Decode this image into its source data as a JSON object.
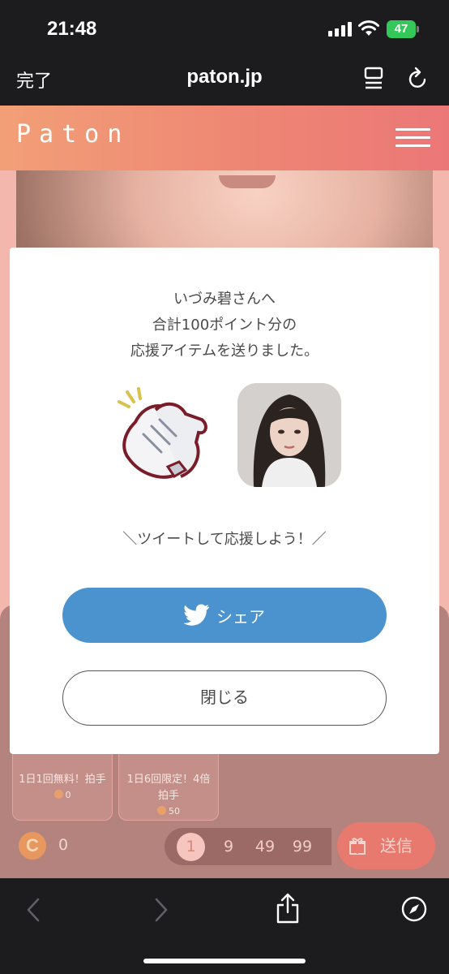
{
  "status_bar": {
    "time": "21:48",
    "battery": "47"
  },
  "browser": {
    "done_label": "完了",
    "url": "paton.jp"
  },
  "site": {
    "logo": "Paton",
    "brand_gradient": [
      "#f29f77",
      "#ec7777"
    ]
  },
  "modal": {
    "message_line1": "いづみ碧さんへ",
    "message_line2": "合計100ポイント分の",
    "message_line3": "応援アイテムを送りました。",
    "tweet_prompt": "＼ツイートして応援しよう！／",
    "share_label": "シェア",
    "close_label": "閉じる",
    "share_color": "#4a93cf"
  },
  "items": [
    {
      "name": "1日1回無料！拍手",
      "price": "0"
    },
    {
      "name": "1日6回限定！4倍拍手",
      "price": "50"
    }
  ],
  "wallet": {
    "coin_symbol": "C",
    "balance": "0"
  },
  "multiplier_options": [
    "1",
    "9",
    "49",
    "99"
  ],
  "selected_multiplier": "1",
  "send_label": "送信",
  "icons": [
    "signal-icon",
    "wifi-icon",
    "battery-icon",
    "reader-icon",
    "reload-icon",
    "hamburger-icon",
    "clap-icon",
    "twitter-bird-icon",
    "coin-icon",
    "gift-icon",
    "back-arrow-icon",
    "forward-arrow-icon",
    "share-icon",
    "compass-icon"
  ]
}
